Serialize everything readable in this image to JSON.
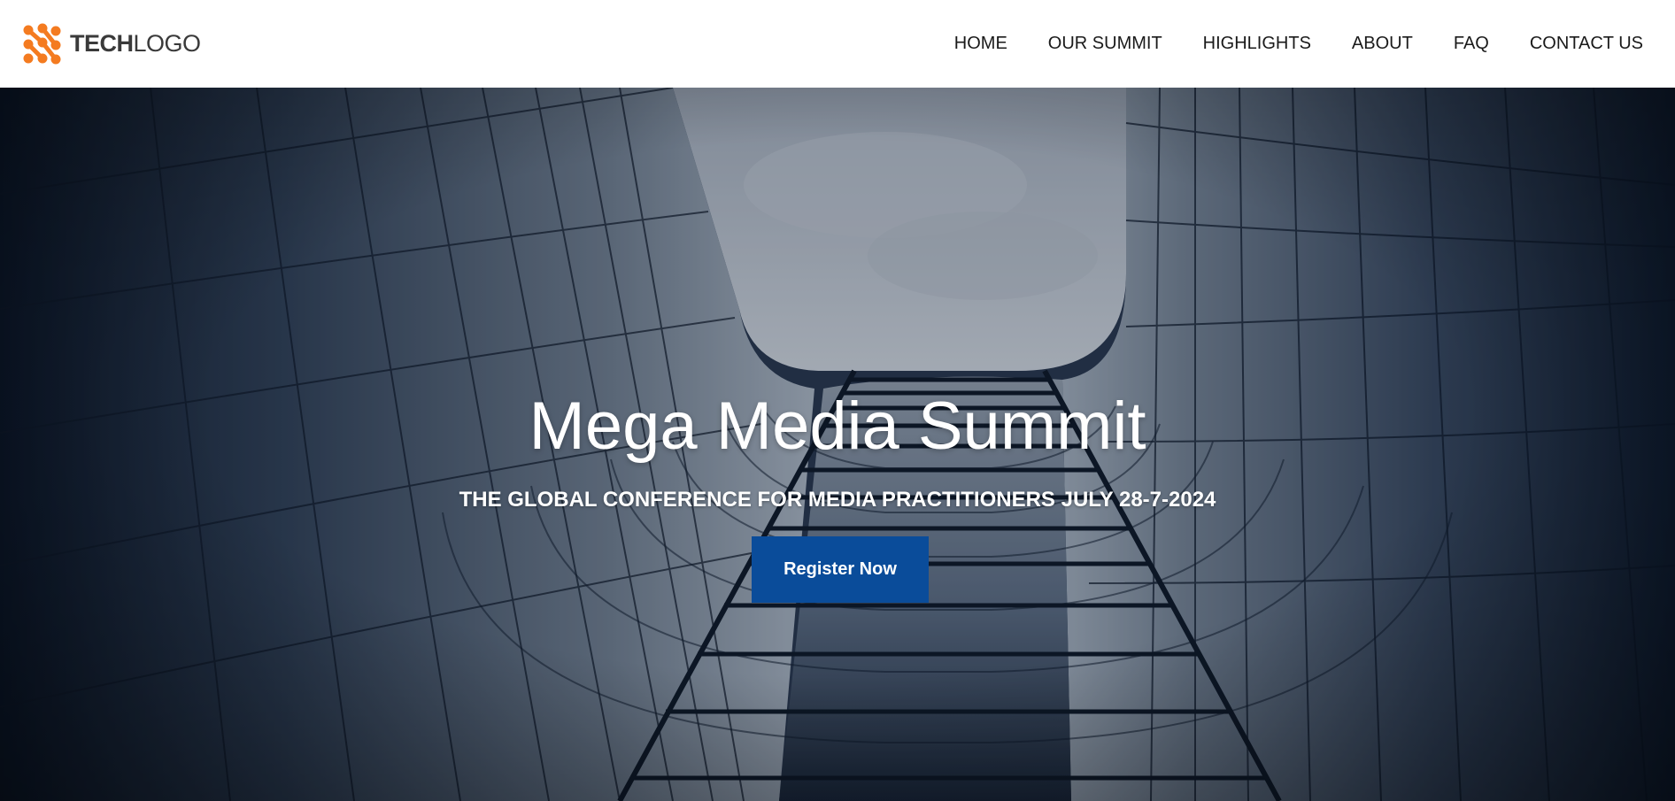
{
  "brand": {
    "logo_bold": "TECH",
    "logo_light": "LOGO",
    "accent_color": "#f47b20"
  },
  "nav": {
    "items": [
      {
        "label": "HOME"
      },
      {
        "label": "OUR SUMMIT"
      },
      {
        "label": "HIGHLIGHTS"
      },
      {
        "label": "ABOUT"
      },
      {
        "label": "FAQ"
      },
      {
        "label": "CONTACT US"
      }
    ]
  },
  "hero": {
    "title": "Mega Media Summit",
    "subtitle": "THE GLOBAL CONFERENCE FOR MEDIA PRACTITIONERS JULY 28-7-2024",
    "cta_label": "Register Now",
    "cta_color": "#0a4c9a"
  }
}
